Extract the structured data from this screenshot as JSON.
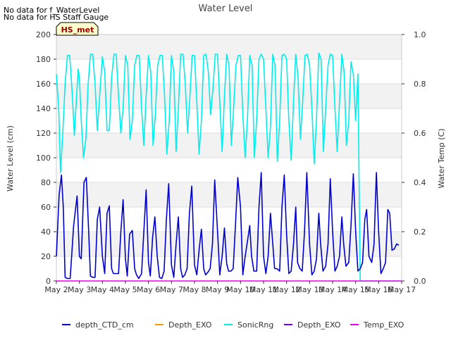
{
  "notes": [
    "No data for f_WaterLevel",
    "No data for HS Staff Gauge"
  ],
  "badge": "HS_met",
  "chart_data": {
    "type": "line",
    "title": "Water Level",
    "ylabel": "Water Level (cm)",
    "y2label": "Water Temp (C)",
    "xlim": [
      "2024-05-02",
      "2024-05-17"
    ],
    "ylim": [
      0,
      200
    ],
    "y2lim": [
      0,
      1.0
    ],
    "x_ticks": [
      "May 2",
      "May 3",
      "May 4",
      "May 5",
      "May 6",
      "May 7",
      "May 8",
      "May 9",
      "May 10",
      "May 11",
      "May 12",
      "May 13",
      "May 14",
      "May 15",
      "May 16",
      "May 17"
    ],
    "y_ticks": [
      0,
      20,
      40,
      60,
      80,
      100,
      120,
      140,
      160,
      180,
      200
    ],
    "y2_ticks": [
      "0.0",
      "0.2",
      "0.4",
      "0.6",
      "0.8",
      "1.0"
    ],
    "grid": true,
    "legend_position": "bottom",
    "series": [
      {
        "name": "depth_CTD_cm",
        "color": "#0000cc",
        "axis": "left",
        "x_days": [
          0.0,
          0.12,
          0.22,
          0.3,
          0.38,
          0.48,
          0.6,
          0.75,
          0.9,
          1.0,
          1.08,
          1.2,
          1.3,
          1.4,
          1.48,
          1.58,
          1.68,
          1.78,
          1.88,
          2.0,
          2.1,
          2.2,
          2.3,
          2.4,
          2.48,
          2.58,
          2.7,
          2.8,
          2.9,
          3.0,
          3.08,
          3.18,
          3.3,
          3.4,
          3.48,
          3.58,
          3.7,
          3.8,
          3.9,
          4.0,
          4.08,
          4.18,
          4.28,
          4.38,
          4.48,
          4.58,
          4.68,
          4.78,
          4.88,
          5.0,
          5.1,
          5.2,
          5.3,
          5.4,
          5.48,
          5.58,
          5.68,
          5.78,
          5.88,
          6.0,
          6.1,
          6.2,
          6.3,
          6.4,
          6.48,
          6.58,
          6.68,
          6.78,
          6.88,
          7.0,
          7.1,
          7.2,
          7.3,
          7.4,
          7.48,
          7.58,
          7.68,
          7.78,
          7.88,
          8.0,
          8.1,
          8.2,
          8.3,
          8.4,
          8.48,
          8.58,
          8.7,
          8.8,
          8.9,
          9.0,
          9.1,
          9.2,
          9.3,
          9.4,
          9.48,
          9.58,
          9.7,
          9.8,
          9.9,
          10.0,
          10.1,
          10.2,
          10.3,
          10.4,
          10.48,
          10.58,
          10.68,
          10.78,
          10.88,
          11.0,
          11.1,
          11.2,
          11.3,
          11.4,
          11.48,
          11.58,
          11.7,
          11.8,
          11.9,
          12.0,
          12.1,
          12.2,
          12.3,
          12.4,
          12.48,
          12.58,
          12.7,
          12.8,
          12.9,
          13.0,
          13.1,
          13.2,
          13.3,
          13.4,
          13.48,
          13.58,
          13.7,
          13.8,
          13.9,
          14.0,
          14.1,
          14.2,
          14.3,
          14.4,
          14.48,
          14.58,
          14.68,
          14.78,
          14.88,
          15.0,
          15.05,
          15.1
        ],
        "values": [
          20,
          70,
          86,
          60,
          3,
          2,
          2,
          45,
          69,
          20,
          18,
          80,
          84,
          42,
          4,
          3,
          3,
          50,
          60,
          20,
          6,
          55,
          61,
          10,
          6,
          6,
          6,
          40,
          66,
          18,
          4,
          38,
          41,
          10,
          5,
          2,
          6,
          40,
          74,
          15,
          4,
          35,
          52,
          20,
          3,
          2,
          8,
          50,
          79,
          13,
          3,
          30,
          52,
          10,
          3,
          5,
          10,
          55,
          77,
          13,
          5,
          25,
          42,
          10,
          5,
          7,
          10,
          30,
          82,
          40,
          5,
          20,
          43,
          14,
          8,
          8,
          10,
          45,
          84,
          60,
          5,
          20,
          32,
          45,
          20,
          8,
          8,
          60,
          88,
          20,
          6,
          20,
          55,
          30,
          10,
          10,
          8,
          60,
          86,
          38,
          6,
          8,
          30,
          60,
          15,
          10,
          8,
          40,
          88,
          30,
          5,
          8,
          18,
          55,
          30,
          8,
          12,
          30,
          83,
          40,
          8,
          12,
          20,
          52,
          30,
          12,
          15,
          45,
          87,
          40,
          8,
          10,
          15,
          50,
          58,
          20,
          15,
          30,
          88,
          40,
          6,
          10,
          15,
          58,
          55,
          25,
          26,
          30,
          29
        ]
      },
      {
        "name": "Depth_EXO",
        "color": "#ff9900",
        "axis": "left",
        "x_days": [],
        "values": []
      },
      {
        "name": "SonicRng",
        "color": "#00eeee",
        "axis": "left",
        "x_days": [
          0.0,
          0.1,
          0.18,
          0.28,
          0.38,
          0.48,
          0.58,
          0.68,
          0.78,
          0.88,
          0.95,
          1.0,
          1.08,
          1.18,
          1.28,
          1.38,
          1.48,
          1.58,
          1.68,
          1.78,
          1.88,
          2.0,
          2.1,
          2.2,
          2.3,
          2.4,
          2.5,
          2.6,
          2.7,
          2.8,
          2.9,
          3.0,
          3.1,
          3.2,
          3.3,
          3.4,
          3.5,
          3.6,
          3.7,
          3.8,
          3.9,
          4.0,
          4.1,
          4.2,
          4.3,
          4.4,
          4.5,
          4.6,
          4.7,
          4.8,
          4.9,
          5.0,
          5.1,
          5.2,
          5.3,
          5.4,
          5.5,
          5.6,
          5.7,
          5.8,
          5.9,
          6.0,
          6.1,
          6.2,
          6.3,
          6.4,
          6.5,
          6.6,
          6.7,
          6.8,
          6.9,
          7.0,
          7.1,
          7.2,
          7.3,
          7.4,
          7.5,
          7.6,
          7.7,
          7.8,
          7.9,
          8.0,
          8.1,
          8.2,
          8.3,
          8.4,
          8.5,
          8.6,
          8.7,
          8.8,
          8.9,
          9.0,
          9.1,
          9.2,
          9.3,
          9.4,
          9.5,
          9.6,
          9.7,
          9.8,
          9.9,
          10.0,
          10.1,
          10.2,
          10.3,
          10.4,
          10.5,
          10.6,
          10.7,
          10.8,
          10.9,
          11.0,
          11.1,
          11.2,
          11.3,
          11.4,
          11.5,
          11.6,
          11.7,
          11.8,
          11.9,
          12.0,
          12.1,
          12.2,
          12.3,
          12.4,
          12.5,
          12.6,
          12.7,
          12.8,
          12.9,
          13.0,
          13.1,
          13.2,
          13.3,
          13.4,
          13.5,
          13.6,
          13.7,
          13.8,
          13.9,
          14.0,
          14.1,
          14.2,
          14.3,
          14.4,
          14.5,
          14.6,
          14.7,
          14.8,
          14.9,
          15.0,
          15.1,
          15.2
        ],
        "values": [
          168,
          140,
          88,
          120,
          160,
          183,
          183,
          155,
          118,
          150,
          172,
          165,
          130,
          100,
          115,
          160,
          184,
          184,
          160,
          122,
          150,
          182,
          170,
          122,
          122,
          165,
          184,
          184,
          150,
          120,
          140,
          183,
          175,
          115,
          130,
          175,
          183,
          183,
          140,
          110,
          150,
          183,
          170,
          110,
          135,
          175,
          183,
          183,
          150,
          103,
          130,
          183,
          170,
          105,
          140,
          184,
          184,
          160,
          120,
          150,
          183,
          183,
          145,
          103,
          130,
          183,
          184,
          170,
          135,
          155,
          184,
          184,
          145,
          105,
          150,
          184,
          175,
          110,
          140,
          175,
          183,
          183,
          135,
          100,
          130,
          183,
          175,
          100,
          130,
          180,
          184,
          180,
          140,
          100,
          125,
          184,
          175,
          97,
          130,
          183,
          184,
          180,
          130,
          98,
          145,
          184,
          165,
          115,
          145,
          183,
          184,
          175,
          140,
          95,
          130,
          185,
          180,
          105,
          140,
          175,
          184,
          183,
          140,
          105,
          145,
          184,
          170,
          110,
          130,
          178,
          168,
          130,
          168,
          0,
          0,
          0,
          0,
          0,
          0,
          0,
          0,
          0,
          0,
          0,
          0,
          0,
          0,
          0,
          0,
          0,
          0,
          0,
          0,
          0,
          0,
          0,
          0
        ]
      },
      {
        "name": "Depth_EXO",
        "color": "#7700cc",
        "axis": "right",
        "x_days": [],
        "values": []
      },
      {
        "name": "Temp_EXO",
        "color": "#ee00ee",
        "axis": "right",
        "x_days": [
          0.0,
          15.0
        ],
        "values": [
          0.0,
          0.0
        ]
      }
    ]
  }
}
